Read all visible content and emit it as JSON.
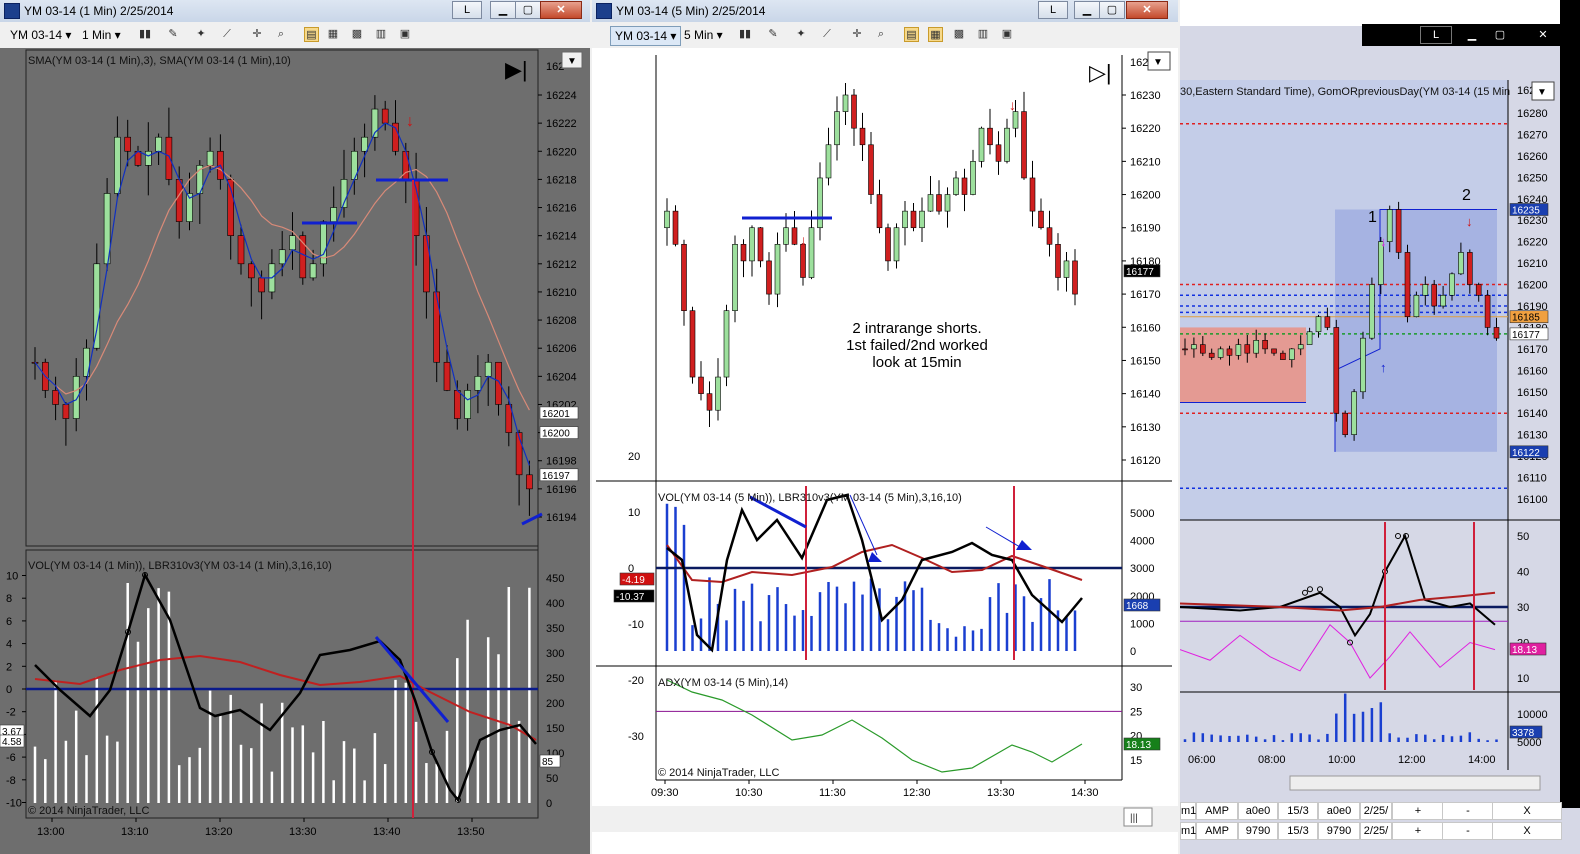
{
  "windows": {
    "left": {
      "title": "YM 03-14 (1 Min)  2/25/2014",
      "instrument": "YM 03-14",
      "interval": "1 Min",
      "price_panel_label": "SMA(YM 03-14 (1 Min),3), SMA(YM 03-14 (1 Min),10)",
      "price_ticks": [
        "16224",
        "16222",
        "16220",
        "16218",
        "16216",
        "16214",
        "16212",
        "16210",
        "16208",
        "16206",
        "16204",
        "16202",
        "16200",
        "16198",
        "16196",
        "16194"
      ],
      "price_tick_values": [
        16224,
        16222,
        16220,
        16218,
        16216,
        16214,
        16212,
        16210,
        16208,
        16206,
        16204,
        16202,
        16200,
        16198,
        16196,
        16194
      ],
      "price_top_cut": "162",
      "price_flags": [
        {
          "text": "16201",
          "value": 16201.4,
          "color": "#ffffff"
        },
        {
          "text": "16200",
          "value": 16200,
          "color": "#ffffff"
        },
        {
          "text": "16197",
          "value": 16197,
          "color": "#ffffff"
        }
      ],
      "osc_label": "VOL(YM 03-14 (1 Min)), LBR310v3(YM 03-14 (1 Min),3,16,10)",
      "osc_ticks_left": [
        "10",
        "8",
        "6",
        "4",
        "2",
        "0",
        "-2",
        "-4",
        "-6",
        "-8",
        "-10"
      ],
      "osc_ticks_right": [
        "450",
        "400",
        "350",
        "300",
        "250",
        "200",
        "150",
        "100",
        "50",
        "0"
      ],
      "osc_flags": [
        "3.67",
        "4.58"
      ],
      "osc_flag_right": "85",
      "copyright": "© 2014 NinjaTrader, LLC",
      "time_ticks": [
        "13:00",
        "13:10",
        "13:20",
        "13:30",
        "13:40",
        "13:50"
      ]
    },
    "middle": {
      "title": "YM 03-14 (5 Min)  2/25/2014",
      "instrument": "YM 03-14",
      "interval": "5 Min",
      "price_ticks": [
        "16230",
        "16220",
        "16210",
        "16200",
        "16190",
        "16180",
        "16170",
        "16160",
        "16150",
        "16140",
        "16130",
        "16120"
      ],
      "price_tick_values": [
        16230,
        16220,
        16210,
        16200,
        16190,
        16180,
        16170,
        16160,
        16150,
        16140,
        16130,
        16120
      ],
      "price_top_cut": "162",
      "price_flag": "16177",
      "annotation": [
        "2 intrarange shorts.",
        "1st failed/2nd worked",
        "look at 15min"
      ],
      "vol_label": "VOL(YM 03-14 (5 Min)), LBR310v3(YM 03-14 (5 Min),3,16,10)",
      "vol_ticks_left": [
        "20",
        "10",
        "0",
        "-10",
        "-20",
        "-30"
      ],
      "vol_ticks_right": [
        "5000",
        "4000",
        "3000",
        "2000",
        "1000",
        "0"
      ],
      "vol_flags": {
        "red": "-4.19",
        "black": "-10.37",
        "blue": "1668"
      },
      "adx_label": "ADX(YM 03-14 (5 Min),14)",
      "adx_ticks": [
        "30",
        "25",
        "20",
        "15"
      ],
      "adx_flag": "18.13",
      "copyright": "© 2014 NinjaTrader, LLC",
      "time_ticks": [
        "09:30",
        "10:30",
        "11:30",
        "12:30",
        "13:30",
        "14:30"
      ]
    },
    "right": {
      "price_panel_label": "30,Eastern Standard Time), GomORpreviousDay(YM 03-14 (15 Min",
      "price_ticks": [
        "16280",
        "16270",
        "16260",
        "16250",
        "16240",
        "16230",
        "16220",
        "16210",
        "16200",
        "16190",
        "16180",
        "16170",
        "16160",
        "16150",
        "16140",
        "16130",
        "16120",
        "16110",
        "16100"
      ],
      "price_tick_values": [
        16280,
        16270,
        16260,
        16250,
        16240,
        16230,
        16220,
        16210,
        16200,
        16190,
        16180,
        16170,
        16160,
        16150,
        16140,
        16130,
        16120,
        16110,
        16100
      ],
      "price_top_cut": "162",
      "price_flags": [
        {
          "text": "16235",
          "value": 16235,
          "color": "#1a3fb0"
        },
        {
          "text": "16185",
          "value": 16185,
          "color": "#f0a040"
        },
        {
          "text": "16177",
          "value": 16177,
          "color": "#ffffff"
        },
        {
          "text": "16122",
          "value": 16122,
          "color": "#1a3fb0"
        }
      ],
      "markers": [
        "1",
        "2"
      ],
      "osc_ticks": [
        "50",
        "40",
        "30",
        "20",
        "10"
      ],
      "osc_flag": "18.13",
      "vol_ticks": [
        "10000",
        "5000"
      ],
      "vol_flag": "3378",
      "time_ticks": [
        "06:00",
        "08:00",
        "10:00",
        "12:00",
        "14:00"
      ],
      "grid_rows": [
        [
          "m1",
          "AMP",
          "a0e0",
          "15/3",
          "a0e0",
          "2/25/",
          "+",
          "-",
          "X"
        ],
        [
          "m1",
          "AMP",
          "9790",
          "15/3",
          "9790",
          "2/25/",
          "+",
          "-",
          "X"
        ]
      ]
    }
  },
  "colors": {
    "up": "#9de09d",
    "down": "#d01f1f",
    "sma_fast": "#1030c0",
    "sma_slow": "#d88a78",
    "vline": "#d0203a"
  }
}
